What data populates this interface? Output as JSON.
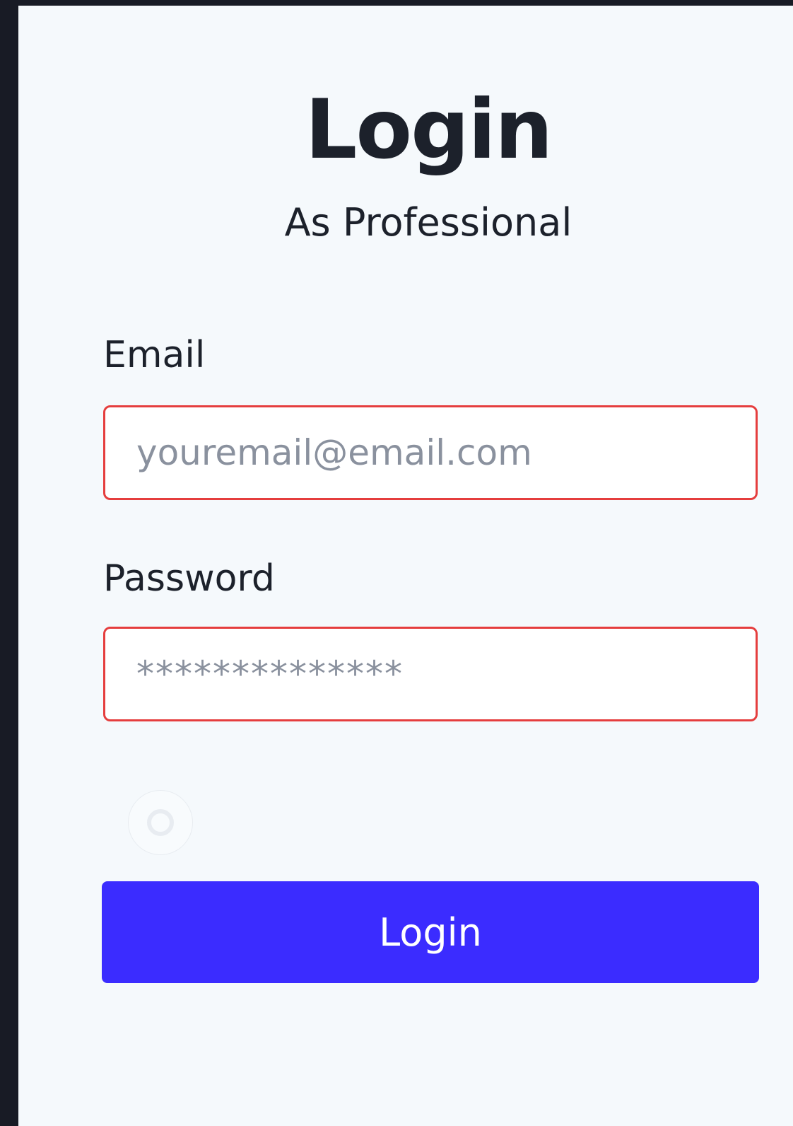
{
  "header": {
    "title": "Login",
    "subtitle": "As Professional"
  },
  "form": {
    "email_label": "Email",
    "email_placeholder": "youremail@email.com",
    "password_label": "Password",
    "password_placeholder": "**************",
    "submit_label": "Login"
  },
  "colors": {
    "background": "#181b25",
    "panel": "#f5f9fc",
    "text": "#1c212b",
    "field_border_error": "#e53e3e",
    "button_primary": "#3b2cff"
  },
  "icons": {
    "loading": "loading-spinner-icon"
  }
}
